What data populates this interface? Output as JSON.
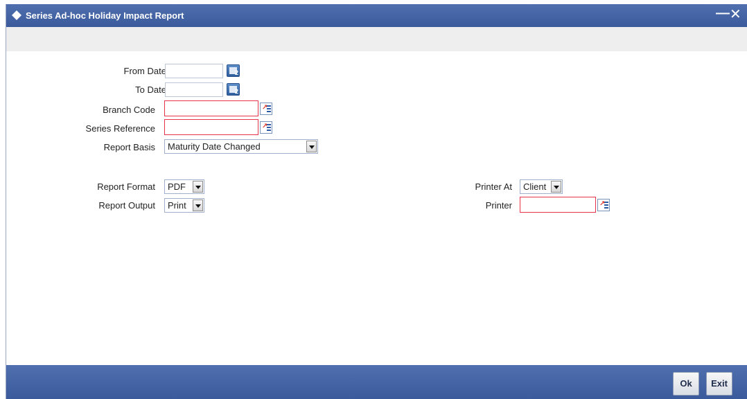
{
  "window": {
    "title": "Series Ad-hoc Holiday Impact Report",
    "minimize_icon": "minimize-icon",
    "close_icon": "close-icon"
  },
  "form": {
    "from_date": {
      "label": "From Date",
      "required": "*",
      "value": ""
    },
    "to_date": {
      "label": "To Date",
      "required": "*",
      "value": ""
    },
    "branch_code": {
      "label": "Branch Code",
      "value": ""
    },
    "series_reference": {
      "label": "Series Reference",
      "value": ""
    },
    "report_basis": {
      "label": "Report Basis",
      "value": "Maturity Date Changed"
    },
    "report_format": {
      "label": "Report Format",
      "value": "PDF"
    },
    "report_output": {
      "label": "Report Output",
      "value": "Print"
    },
    "printer_at": {
      "label": "Printer At",
      "value": "Client"
    },
    "printer": {
      "label": "Printer",
      "value": ""
    }
  },
  "footer": {
    "ok_label": "Ok",
    "exit_label": "Exit"
  },
  "colors": {
    "titlebar": "#3f5f9f",
    "mandatory_border": "#e6334a",
    "required_star": "#cc0000"
  }
}
